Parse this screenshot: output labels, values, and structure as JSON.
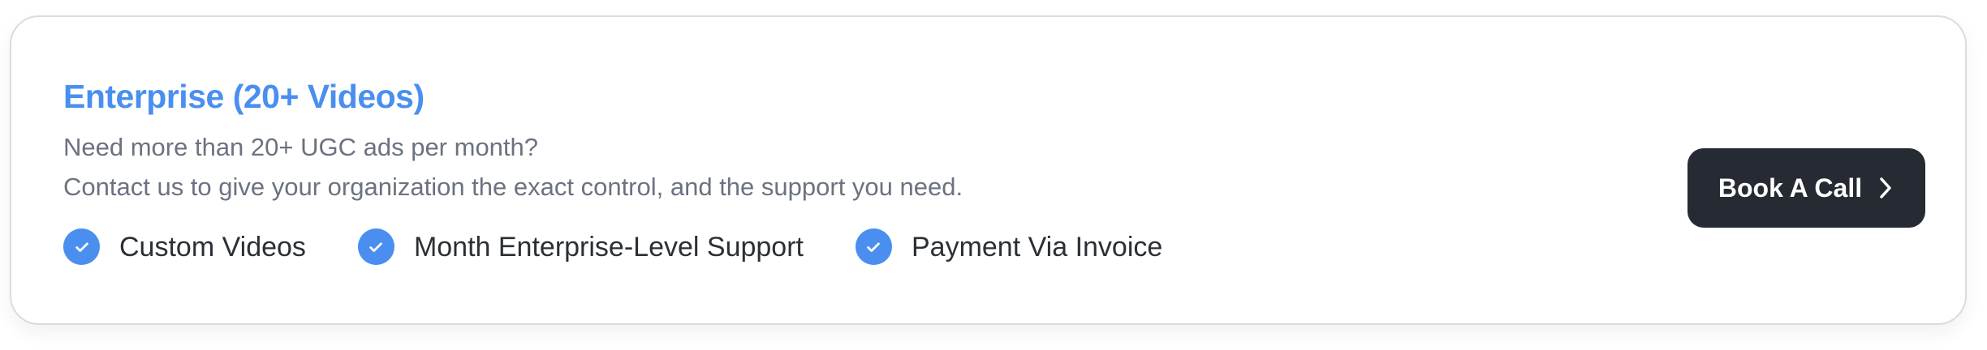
{
  "card": {
    "title": "Enterprise (20+ Videos)",
    "description_lines": [
      "Need more than 20+ UGC ads per month?",
      "Contact us to give your organization the exact control, and the support you need."
    ],
    "features": [
      {
        "label": "Custom Videos",
        "icon": "check-circle-icon"
      },
      {
        "label": "Month Enterprise-Level Support",
        "icon": "check-circle-icon"
      },
      {
        "label": "Payment Via Invoice",
        "icon": "check-circle-icon"
      }
    ],
    "cta": {
      "label": "Book A Call",
      "icon": "chevron-right-icon"
    }
  },
  "colors": {
    "accent": "#4a8ff0",
    "text_muted": "#6b7280",
    "text_dark": "#2b2f36",
    "button_bg": "#252a33",
    "border": "#dcdcdc"
  }
}
